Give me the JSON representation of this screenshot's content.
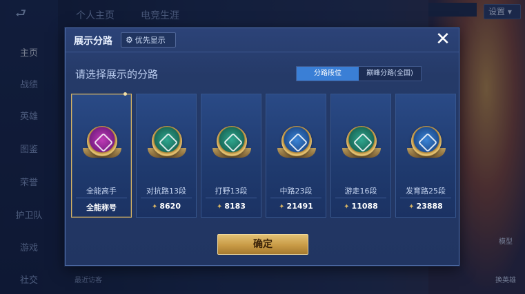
{
  "top_tabs": [
    "个人主页",
    "电竞生涯"
  ],
  "settings_label": "设置",
  "top_status_text": "",
  "sidebar": {
    "back_icon": "back-arrow-icon",
    "items": [
      "主页",
      "战绩",
      "英雄",
      "图鉴",
      "荣誉",
      "护卫队",
      "游戏",
      "社交"
    ],
    "active_index": 0
  },
  "modal": {
    "title": "展示分路",
    "priority_label": "优先显示",
    "priority_icon": "gear-icon",
    "close_icon": "close-icon",
    "subtitle": "请选择展示的分路",
    "toggle": {
      "options": [
        "分路段位",
        "巅峰分路(全国)"
      ],
      "selected_index": 0
    },
    "cards": [
      {
        "name": "全能高手",
        "foot": "全能称号",
        "score": "",
        "selected": true,
        "inner": "#c03bb6",
        "inner2": "#7b1f86"
      },
      {
        "name": "对抗路13段",
        "foot": "",
        "score": "8620",
        "selected": false,
        "inner": "#2fa890",
        "inner2": "#1a6b5a"
      },
      {
        "name": "打野13段",
        "foot": "",
        "score": "8183",
        "selected": false,
        "inner": "#2fa890",
        "inner2": "#1a6b5a"
      },
      {
        "name": "中路23段",
        "foot": "",
        "score": "21491",
        "selected": false,
        "inner": "#3c86d8",
        "inner2": "#1f4f92"
      },
      {
        "name": "游走16段",
        "foot": "",
        "score": "11088",
        "selected": false,
        "inner": "#2fa890",
        "inner2": "#1a6b5a"
      },
      {
        "name": "发育路25段",
        "foot": "",
        "score": "23888",
        "selected": false,
        "inner": "#3c86d8",
        "inner2": "#1f4f92"
      }
    ],
    "confirm_label": "确定"
  },
  "bottom": {
    "visitors_label": "最近访客",
    "right_labels": [
      "模型",
      "换英雄"
    ]
  },
  "colors": {
    "accent_gold": "#d8b564",
    "toggle_selected": "#3a7fd6"
  }
}
